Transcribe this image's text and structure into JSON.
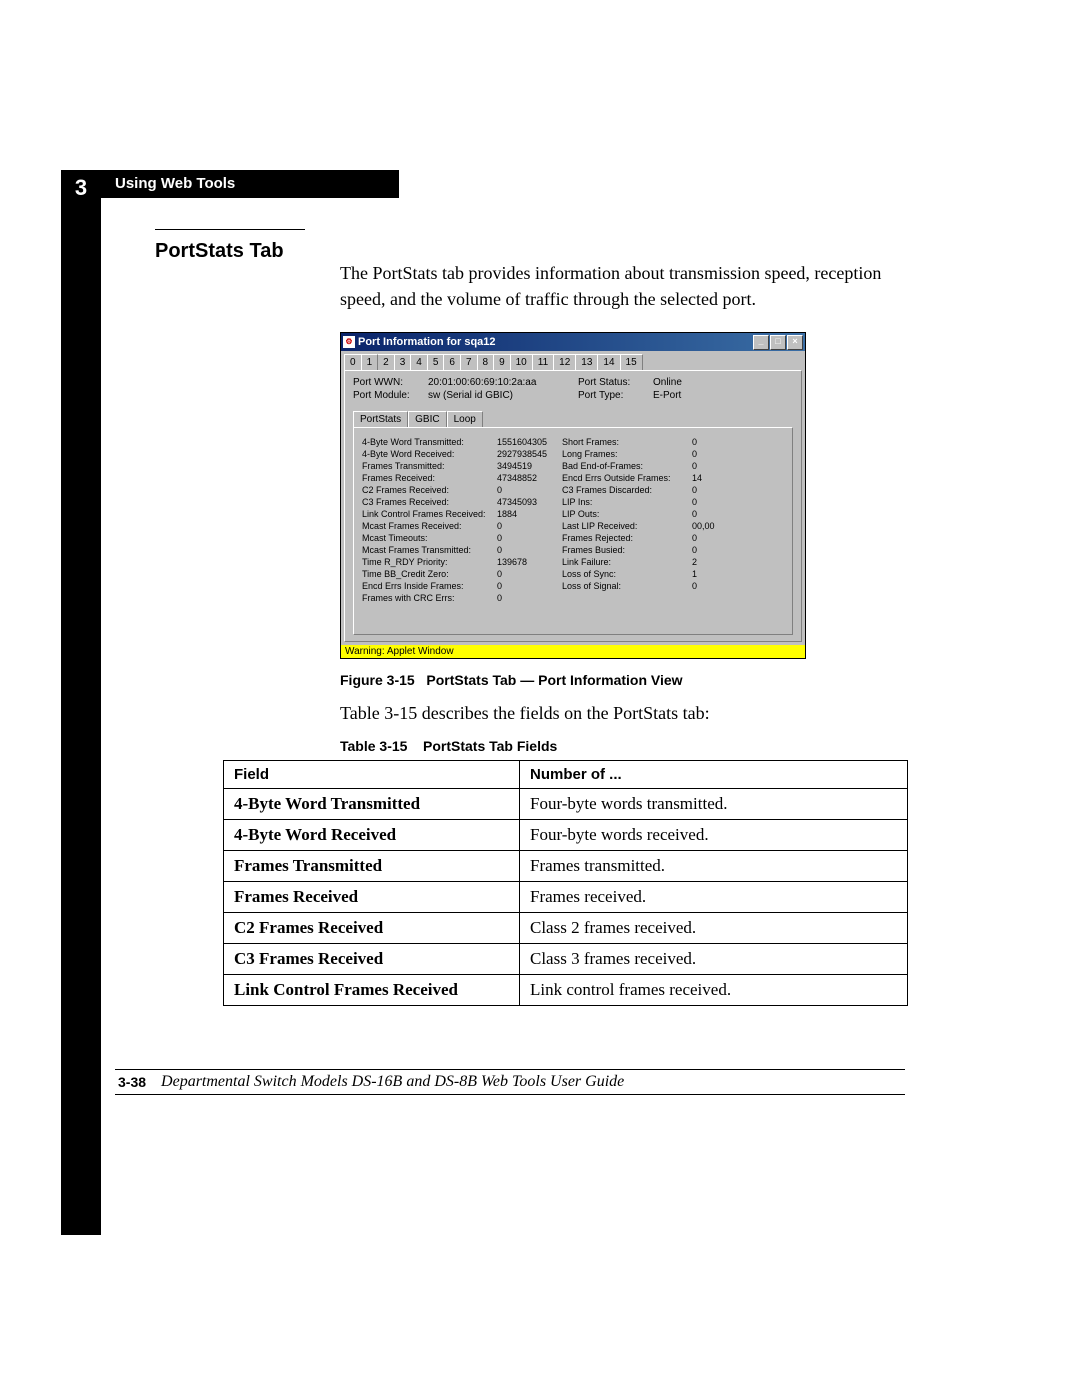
{
  "chapter_number": "3",
  "header_title": "Using Web Tools",
  "section_title": "PortStats Tab",
  "paragraph1": "The PortStats tab provides information about transmission speed, reception speed, and the volume of traffic through the selected port.",
  "figure": {
    "window_title": "Port Information for sqa12",
    "tabs": [
      "0",
      "1",
      "2",
      "3",
      "4",
      "5",
      "6",
      "7",
      "8",
      "9",
      "10",
      "11",
      "12",
      "13",
      "14",
      "15"
    ],
    "active_tab_index": 1,
    "info": {
      "port_wwn_label": "Port WWN:",
      "port_wwn_value": "20:01:00:60:69:10:2a:aa",
      "port_module_label": "Port Module:",
      "port_module_value": "sw (Serial id GBIC)",
      "port_status_label": "Port Status:",
      "port_status_value": "Online",
      "port_type_label": "Port Type:",
      "port_type_value": "E-Port"
    },
    "subtabs": [
      "PortStats",
      "GBIC",
      "Loop"
    ],
    "active_subtab_index": 0,
    "stats_left": [
      {
        "label": "4-Byte Word Transmitted:",
        "value": "1551604305"
      },
      {
        "label": "4-Byte Word Received:",
        "value": "2927938545"
      },
      {
        "label": "Frames Transmitted:",
        "value": "3494519"
      },
      {
        "label": "Frames Received:",
        "value": "47348852"
      },
      {
        "label": "C2 Frames Received:",
        "value": "0"
      },
      {
        "label": "C3 Frames Received:",
        "value": "47345093"
      },
      {
        "label": "Link Control Frames Received:",
        "value": "1884"
      },
      {
        "label": "Mcast Frames Received:",
        "value": "0"
      },
      {
        "label": "Mcast Timeouts:",
        "value": "0"
      },
      {
        "label": "Mcast Frames Transmitted:",
        "value": "0"
      },
      {
        "label": "Time R_RDY Priority:",
        "value": "139678"
      },
      {
        "label": "Time BB_Credit Zero:",
        "value": "0"
      },
      {
        "label": "Encd Errs Inside Frames:",
        "value": "0"
      },
      {
        "label": "Frames with CRC Errs:",
        "value": "0"
      }
    ],
    "stats_right": [
      {
        "label": "Short Frames:",
        "value": "0"
      },
      {
        "label": "Long Frames:",
        "value": "0"
      },
      {
        "label": "Bad End-of-Frames:",
        "value": "0"
      },
      {
        "label": "Encd Errs Outside Frames:",
        "value": "14"
      },
      {
        "label": "C3 Frames Discarded:",
        "value": "0"
      },
      {
        "label": "LIP Ins:",
        "value": "0"
      },
      {
        "label": "LIP Outs:",
        "value": "0"
      },
      {
        "label": "Last LIP Received:",
        "value": "00,00"
      },
      {
        "label": "Frames Rejected:",
        "value": "0"
      },
      {
        "label": "Frames Busied:",
        "value": "0"
      },
      {
        "label": "Link Failure:",
        "value": "2"
      },
      {
        "label": "Loss of Sync:",
        "value": "1"
      },
      {
        "label": "Loss of Signal:",
        "value": "0"
      }
    ],
    "warning_text": "Warning: Applet Window"
  },
  "figure_caption_prefix": "Figure 3-15",
  "figure_caption_text": "PortStats Tab — Port Information View",
  "paragraph2": "Table 3-15 describes the fields on the PortStats tab:",
  "table_caption_prefix": "Table 3-15",
  "table_caption_text": "PortStats Tab Fields",
  "table_headers": {
    "field": "Field",
    "desc": "Number of ..."
  },
  "table_rows": [
    {
      "field": "4-Byte Word Transmitted",
      "desc": "Four-byte words transmitted."
    },
    {
      "field": "4-Byte Word Received",
      "desc": "Four-byte words received."
    },
    {
      "field": "Frames Transmitted",
      "desc": "Frames transmitted."
    },
    {
      "field": "Frames Received",
      "desc": "Frames received."
    },
    {
      "field": "C2 Frames Received",
      "desc": "Class 2 frames received."
    },
    {
      "field": "C3 Frames Received",
      "desc": "Class 3 frames received."
    },
    {
      "field": "Link Control Frames Received",
      "desc": "Link control frames received."
    }
  ],
  "footer": {
    "page_number": "3-38",
    "doc_title": "Departmental Switch Models DS-16B and DS-8B Web Tools User Guide"
  }
}
